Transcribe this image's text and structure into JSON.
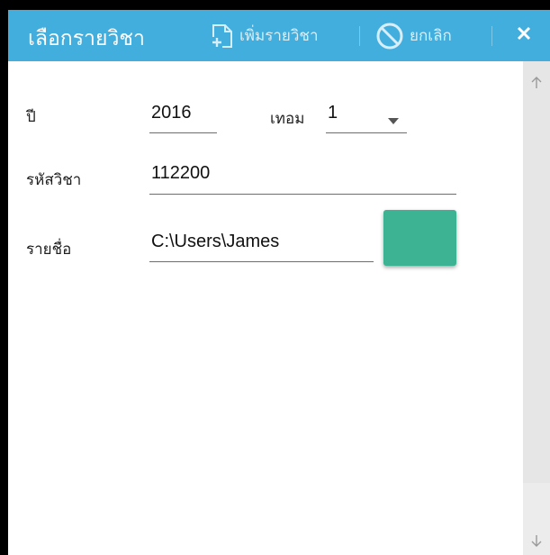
{
  "titlebar": {
    "title": "เลือกรายวิชา",
    "add_label": "เพิ่มรายวิชา",
    "cancel_label": "ยกเลิก"
  },
  "form": {
    "year_label": "ปี",
    "year_value": "2016",
    "term_label": "เทอม",
    "term_value": "1",
    "code_label": "รหัสวิชา",
    "code_value": "112200",
    "list_label": "รายชื่อ",
    "list_value": "C:\\Users\\James"
  },
  "colors": {
    "titlebar": "#41aedd",
    "swatch": "#3db393"
  }
}
